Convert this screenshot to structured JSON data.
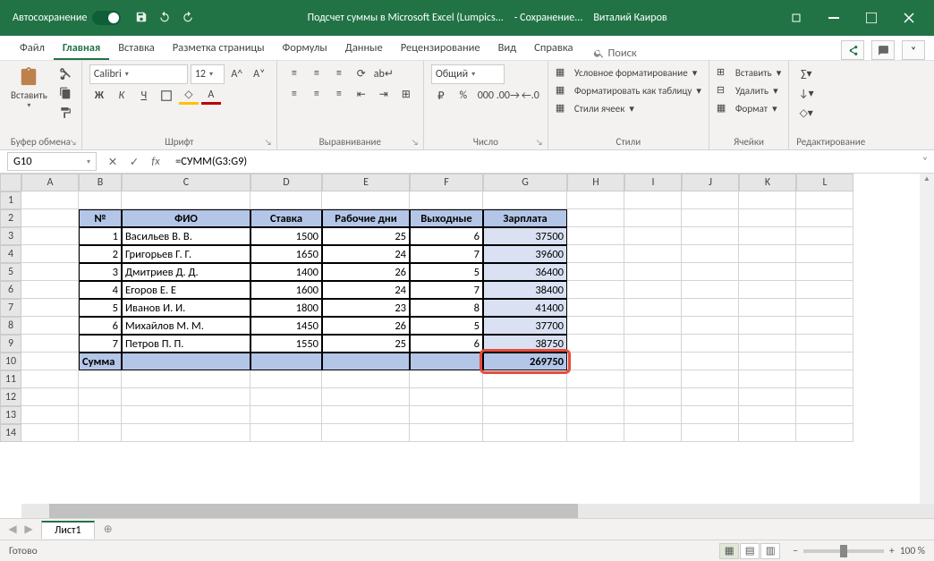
{
  "titlebar": {
    "autosave": "Автосохранение",
    "doc_title": "Подсчет суммы в Microsoft Excel (Lumpics...",
    "saving": "- Сохранение...",
    "user": "Виталий Каиров"
  },
  "tabs": {
    "items": [
      "Файл",
      "Главная",
      "Вставка",
      "Разметка страницы",
      "Формулы",
      "Данные",
      "Рецензирование",
      "Вид",
      "Справка"
    ],
    "active": 1,
    "search": "Поиск"
  },
  "ribbon": {
    "paste": "Вставить",
    "clipboard": "Буфер обмена",
    "font_name": "Calibri",
    "font_size": "12",
    "font": "Шрифт",
    "alignment": "Выравнивание",
    "number_format": "Общий",
    "number": "Число",
    "cond_format": "Условное форматирование",
    "as_table": "Форматировать как таблицу",
    "cell_styles": "Стили ячеек",
    "styles": "Стили",
    "insert": "Вставить",
    "delete": "Удалить",
    "format": "Формат",
    "cells": "Ячейки",
    "editing": "Редактирование"
  },
  "formulabar": {
    "name": "G10",
    "formula": "=СУММ(G3:G9)"
  },
  "columns": [
    "A",
    "B",
    "C",
    "D",
    "E",
    "F",
    "G",
    "H",
    "I",
    "J",
    "K",
    "L"
  ],
  "headers": [
    "№",
    "ФИО",
    "Ставка",
    "Рабочие дни",
    "Выходные",
    "Зарплата"
  ],
  "rows": [
    {
      "n": "1",
      "fio": "Васильев В. В.",
      "rate": "1500",
      "wd": "25",
      "wo": "6",
      "sal": "37500"
    },
    {
      "n": "2",
      "fio": "Григорьев Г. Г.",
      "rate": "1650",
      "wd": "24",
      "wo": "7",
      "sal": "39600"
    },
    {
      "n": "3",
      "fio": "Дмитриев Д. Д.",
      "rate": "1400",
      "wd": "26",
      "wo": "5",
      "sal": "36400"
    },
    {
      "n": "4",
      "fio": "Егоров Е. Е",
      "rate": "1600",
      "wd": "24",
      "wo": "7",
      "sal": "38400"
    },
    {
      "n": "5",
      "fio": "Иванов И. И.",
      "rate": "1800",
      "wd": "23",
      "wo": "8",
      "sal": "41400"
    },
    {
      "n": "6",
      "fio": "Михайлов М. М.",
      "rate": "1450",
      "wd": "26",
      "wo": "5",
      "sal": "37700"
    },
    {
      "n": "7",
      "fio": "Петров П. П.",
      "rate": "1550",
      "wd": "25",
      "wo": "6",
      "sal": "38750"
    }
  ],
  "sum_label": "Сумма",
  "sum_value": "269750",
  "sheet": "Лист1",
  "status": "Готово",
  "zoom": "100 %",
  "chart_data": {
    "type": "table",
    "title": "Salary table",
    "columns": [
      "№",
      "ФИО",
      "Ставка",
      "Рабочие дни",
      "Выходные",
      "Зарплата"
    ],
    "data": [
      [
        1,
        "Васильев В. В.",
        1500,
        25,
        6,
        37500
      ],
      [
        2,
        "Григорьев Г. Г.",
        1650,
        24,
        7,
        39600
      ],
      [
        3,
        "Дмитриев Д. Д.",
        1400,
        26,
        5,
        36400
      ],
      [
        4,
        "Егоров Е. Е",
        1600,
        24,
        7,
        38400
      ],
      [
        5,
        "Иванов И. И.",
        1800,
        23,
        8,
        41400
      ],
      [
        6,
        "Михайлов М. М.",
        1450,
        26,
        5,
        37700
      ],
      [
        7,
        "Петров П. П.",
        1550,
        25,
        6,
        38750
      ]
    ],
    "sum_salary": 269750
  }
}
